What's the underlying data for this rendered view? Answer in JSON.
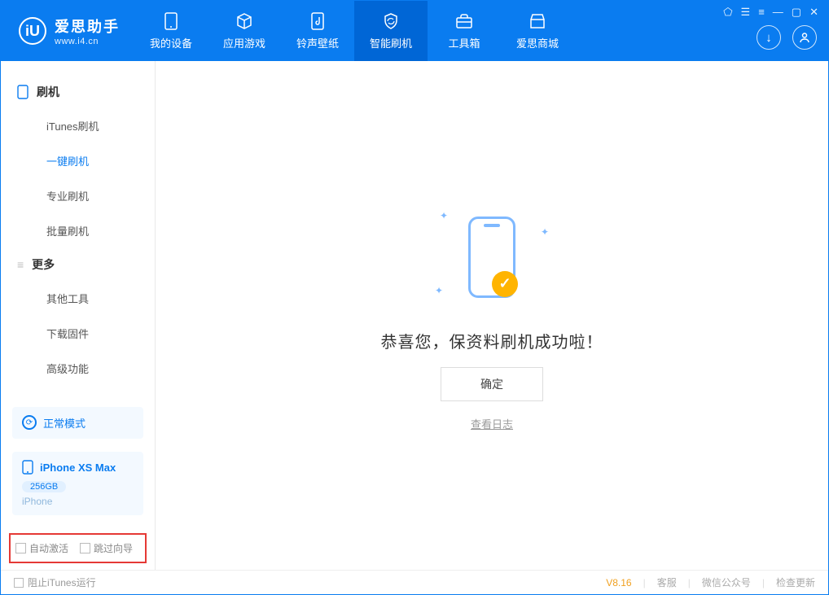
{
  "app": {
    "name": "爱思助手",
    "url": "www.i4.cn"
  },
  "tabs": {
    "device": "我的设备",
    "apps": "应用游戏",
    "ringtones": "铃声壁纸",
    "flash": "智能刷机",
    "tools": "工具箱",
    "store": "爱思商城"
  },
  "sidebar": {
    "group_flash": "刷机",
    "items_flash": {
      "itunes": "iTunes刷机",
      "oneclick": "一键刷机",
      "pro": "专业刷机",
      "batch": "批量刷机"
    },
    "group_more": "更多",
    "items_more": {
      "othertools": "其他工具",
      "firmware": "下载固件",
      "advanced": "高级功能"
    },
    "mode": "正常模式",
    "device_name": "iPhone XS Max",
    "device_storage": "256GB",
    "device_type": "iPhone",
    "chk_activate": "自动激活",
    "chk_skip": "跳过向导"
  },
  "content": {
    "success": "恭喜您，保资料刷机成功啦！",
    "ok": "确定",
    "viewlog": "查看日志"
  },
  "footer": {
    "block_itunes": "阻止iTunes运行",
    "version": "V8.16",
    "support": "客服",
    "wechat": "微信公众号",
    "update": "检查更新"
  }
}
